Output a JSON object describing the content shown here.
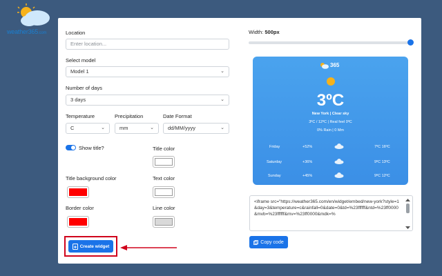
{
  "brand": {
    "name": "weather365",
    "suffix": ".com"
  },
  "form": {
    "location_label": "Location",
    "location_placeholder": "Enter location...",
    "model_label": "Select model",
    "model_value": "Model 1",
    "days_label": "Number of days",
    "days_value": "3 days",
    "temperature_label": "Temperature",
    "temperature_value": "C",
    "precipitation_label": "Precipitation",
    "precipitation_value": "mm",
    "date_format_label": "Date Format",
    "date_format_value": "dd/MM/yyyy",
    "show_title_label": "Show title?",
    "show_title_on": true,
    "title_color_label": "Title color",
    "title_bg_label": "Title background color",
    "text_color_label": "Text color",
    "border_color_label": "Border color",
    "line_color_label": "Line color",
    "create_button": "Create widget"
  },
  "colors": {
    "title_color": "#ffffff",
    "title_bg": "#ff0000",
    "text_color": "#ffffff",
    "border_color": "#ff0000",
    "line_color": "#d9d9d9",
    "accent": "#1a73e8",
    "highlight": "#d0021b"
  },
  "preview": {
    "width_label": "Width:",
    "width_value": "500px",
    "width_fraction": 1.0,
    "logo_text": "365",
    "temperature": "3ºC",
    "location_line": "New York | Clear sky",
    "minmax_line": "3ºC / 12ºC | Real feel 0ºC",
    "rain_line": "0% Rain | 0 Mm",
    "forecast": [
      {
        "day": "Friday",
        "rain": "+52%",
        "range": "7ºC 16ºC"
      },
      {
        "day": "Saturday",
        "rain": "+36%",
        "range": "9ºC 13ºC"
      },
      {
        "day": "Sunday",
        "rain": "+45%",
        "range": "9ºC 12ºC"
      }
    ]
  },
  "embed": {
    "code": "<iframe src=\"https://weather365.com/en/widget/embed/new-york?style=1&day=3&temperature=c&rainfall=0&date=0&td=%23ffffff&ntd=%23ff0000&mvb=%23ffffff&mv=%23ff0000&mdk=%",
    "copy_button": "Copy code"
  },
  "icons": [
    "cloud-sun-icon",
    "widget-icon",
    "copy-icon",
    "chevron-down-icon",
    "sun-icon",
    "cloud-icon"
  ]
}
